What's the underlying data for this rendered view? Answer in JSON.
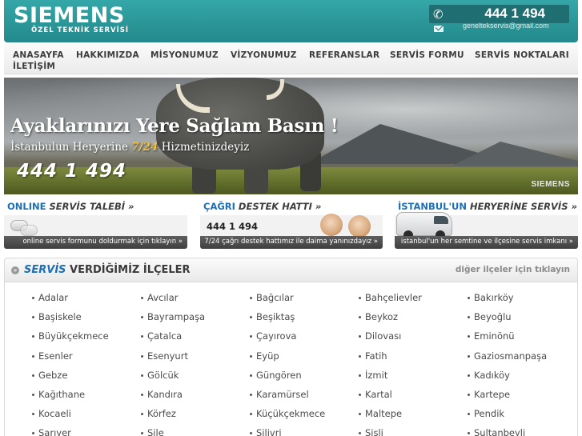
{
  "header": {
    "logo": "SIEMENS",
    "logo_subtitle": "ÖZEL TEKNİK SERVİSİ",
    "phone": "444 1 494",
    "email": "geneltekservis@gmail.com",
    "phone_icon": "phone-icon",
    "mail_icon": "mail-icon"
  },
  "nav": {
    "items": [
      "ANASAYFA",
      "HAKKIMIZDA",
      "MİSYONUMUZ",
      "VİZYONUMUZ",
      "REFERANSLAR",
      "SERVİS FORMU",
      "SERVİS NOKTALARI",
      "İLETİŞİM"
    ]
  },
  "banner": {
    "headline": "Ayaklarınızı Yere Sağlam Basın !",
    "sub_prefix": "İstanbulun Heryerine ",
    "sub_accent": "7/24",
    "sub_suffix": " Hizmetinizdeyiz",
    "phone": "444 1 494",
    "brand": "SIEMENS"
  },
  "promos": [
    {
      "title_blue": "ONLINE",
      "title_dark": " SERVİS TALEBİ »",
      "strip_text": "online servis formunu doldurmak için tıklayın »"
    },
    {
      "title_blue": "ÇAĞRI",
      "title_dark": " DESTEK HATTI »",
      "phone": "444 1 494",
      "strip_text": "7/24 çağrı destek hattımız ile daima yanınızdayız »"
    },
    {
      "title_blue": "İSTANBUL'UN",
      "title_dark": " HERYERİNE SERVİS »",
      "strip_text": "istanbul'un her semtine ve ilçesine servis imkanı »"
    }
  ],
  "districts": {
    "title_blue": "SERVİS",
    "title_dark": " VERDİĞİMİZ İLÇELER",
    "other_link": "diğer ilçeler için tıklayın",
    "items": [
      "Adalar",
      "Avcılar",
      "Bağcılar",
      "Bahçelievler",
      "Bakırköy",
      "Başiskele",
      "Bayrampaşa",
      "Beşiktaş",
      "Beykoz",
      "Beyoğlu",
      "Büyükçekmece",
      "Çatalca",
      "Çayırova",
      "Dilovası",
      "Eminönü",
      "Esenler",
      "Esenyurt",
      "Eyüp",
      "Fatih",
      "Gaziosmanpaşa",
      "Gebze",
      "Gölcük",
      "Güngören",
      "İzmit",
      "Kadıköy",
      "Kağıthane",
      "Kandıra",
      "Karamürsel",
      "Kartal",
      "Kartepe",
      "Kocaeli",
      "Körfez",
      "Küçükçekmece",
      "Maltepe",
      "Pendik",
      "Sarıyer",
      "Şile",
      "Silivri",
      "Şişli",
      "Sultanbeyli"
    ]
  }
}
